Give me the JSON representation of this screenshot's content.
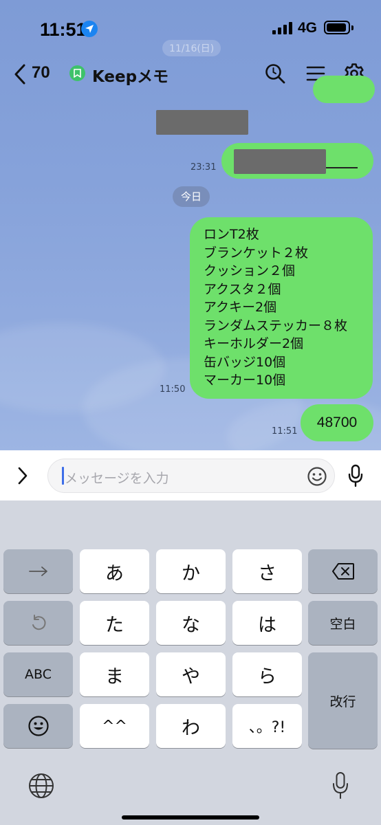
{
  "status_bar": {
    "time": "11:51",
    "network": "4G"
  },
  "header": {
    "unread_count": "70",
    "title": "Keepメモ"
  },
  "background_overlay": {
    "faded_date": "11/16(日)"
  },
  "messages": [
    {
      "side": "left",
      "content": "redacted"
    },
    {
      "side": "right",
      "content": "redacted",
      "time": "23:31"
    },
    {
      "type": "date_separator",
      "label": "今日"
    },
    {
      "side": "right",
      "time": "11:50",
      "lines": [
        "ロンT2枚",
        "ブランケット２枚",
        "クッション２個",
        "アクスタ２個",
        "アクキー2個",
        "ランダムステッカー８枚",
        "キーホルダー2個",
        "缶バッジ10個",
        "マーカー10個"
      ]
    },
    {
      "side": "right",
      "time": "11:51",
      "text": "48700"
    }
  ],
  "input": {
    "placeholder": "メッセージを入力"
  },
  "keyboard": {
    "rows": [
      [
        "→",
        "あ",
        "か",
        "さ",
        "⌫"
      ],
      [
        "↺",
        "た",
        "な",
        "は",
        "空白"
      ],
      [
        "ABC",
        "ま",
        "や",
        "ら",
        "改行"
      ],
      [
        "☺",
        "^^",
        "わ",
        "、。?!"
      ]
    ],
    "space_label": "空白",
    "return_label": "改行",
    "abc_label": "ABC"
  },
  "colors": {
    "bubble_green": "#6ee06b",
    "chat_bg": "#86a2da",
    "keep_green": "#3ec26a"
  }
}
